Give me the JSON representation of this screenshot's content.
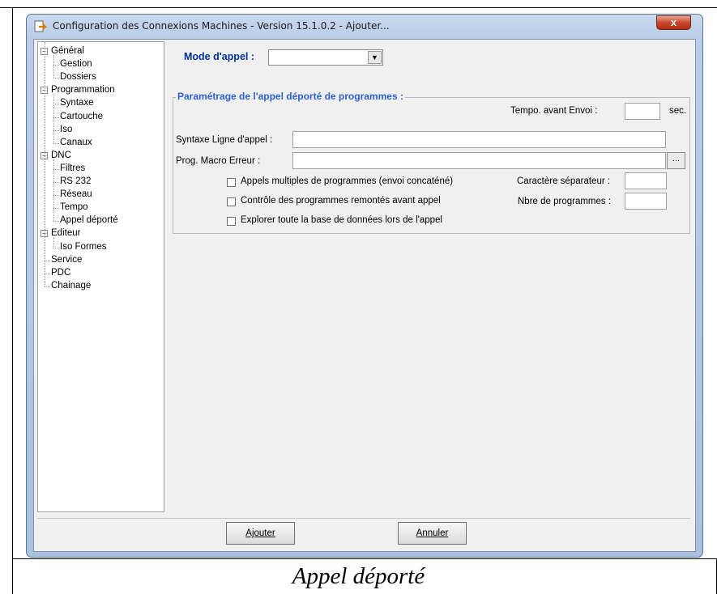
{
  "window": {
    "title": "Configuration des Connexions Machines - Version 15.1.0.2 - Ajouter...",
    "close_glyph": "x"
  },
  "tree": {
    "items": [
      {
        "label": "Général",
        "level": 0,
        "expander": "−"
      },
      {
        "label": "Gestion",
        "level": 1
      },
      {
        "label": "Dossiers",
        "level": 1
      },
      {
        "label": "Programmation",
        "level": 0,
        "expander": "−"
      },
      {
        "label": "Syntaxe",
        "level": 1
      },
      {
        "label": "Cartouche",
        "level": 1
      },
      {
        "label": "Iso",
        "level": 1
      },
      {
        "label": "Canaux",
        "level": 1
      },
      {
        "label": "DNC",
        "level": 0,
        "expander": "−"
      },
      {
        "label": "Filtres",
        "level": 1
      },
      {
        "label": "RS 232",
        "level": 1
      },
      {
        "label": "Réseau",
        "level": 1
      },
      {
        "label": "Tempo",
        "level": 1
      },
      {
        "label": "Appel déporté",
        "level": 1
      },
      {
        "label": "Editeur",
        "level": 0,
        "expander": "−"
      },
      {
        "label": "Iso Formes",
        "level": 1
      },
      {
        "label": "Service",
        "level": 0
      },
      {
        "label": "PDC",
        "level": 0
      },
      {
        "label": "Chainage",
        "level": 0
      }
    ]
  },
  "form": {
    "mode_label": "Mode d'appel :",
    "mode_value": "",
    "group_title": "Paramétrage de l'appel déporté de programmes :",
    "tempo_label": "Tempo. avant Envoi :",
    "tempo_value": "",
    "tempo_unit": "sec.",
    "syntaxe_label": "Syntaxe Ligne d'appel :",
    "syntaxe_value": "",
    "macro_label": "Prog. Macro Erreur :",
    "macro_value": "",
    "browse_label": "...",
    "chk_multiples": "Appels multiples de programmes (envoi concaténé)",
    "chk_controle": "Contrôle des programmes remontés avant appel",
    "chk_explorer": "Explorer toute la base de données lors de l'appel",
    "separateur_label": "Caractère séparateur :",
    "separateur_value": "",
    "nbre_label": "Nbre de programmes :",
    "nbre_value": ""
  },
  "buttons": {
    "ajouter": "Ajouter",
    "annuler": "Annuler"
  },
  "caption": "Appel déporté"
}
